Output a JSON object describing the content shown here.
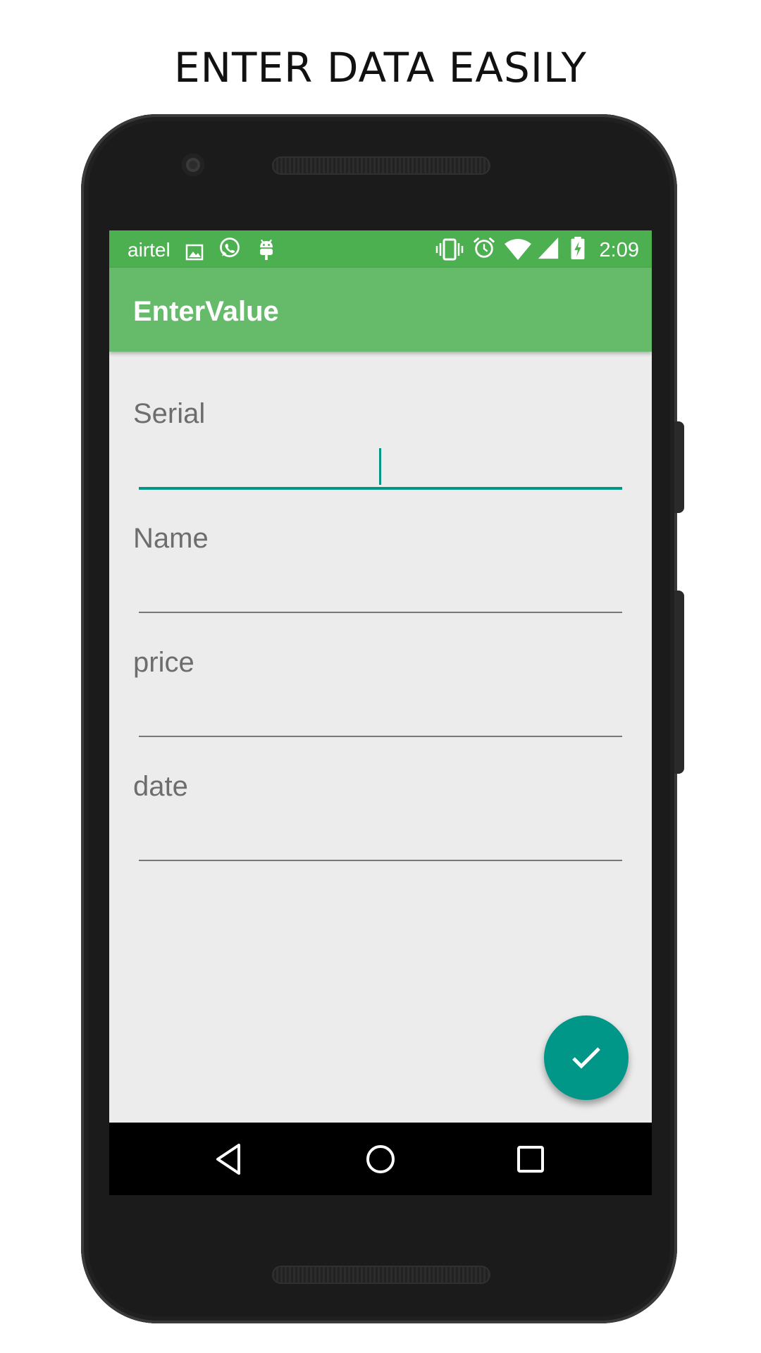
{
  "headline": "ENTER DATA EASILY",
  "status_bar": {
    "carrier": "airtel",
    "time": "2:09",
    "icons_left": [
      "image-icon",
      "whatsapp-icon",
      "android-debug-icon"
    ],
    "icons_right": [
      "vibrate-icon",
      "alarm-icon",
      "wifi-icon",
      "signal-icon",
      "battery-charging-icon"
    ],
    "color": "#4caf50"
  },
  "app_bar": {
    "title": "EnterValue",
    "color": "#66bb6a"
  },
  "form": {
    "fields": [
      {
        "label": "Serial",
        "value": "",
        "focused": true
      },
      {
        "label": "Name",
        "value": ""
      },
      {
        "label": "price",
        "value": ""
      },
      {
        "label": "date",
        "value": ""
      }
    ]
  },
  "fab": {
    "icon": "check-icon",
    "color": "#009688"
  },
  "nav_bar": {
    "buttons": [
      "back-icon",
      "home-icon",
      "recents-icon"
    ]
  },
  "colors": {
    "accent": "#009688",
    "screen_background": "#ececec"
  }
}
